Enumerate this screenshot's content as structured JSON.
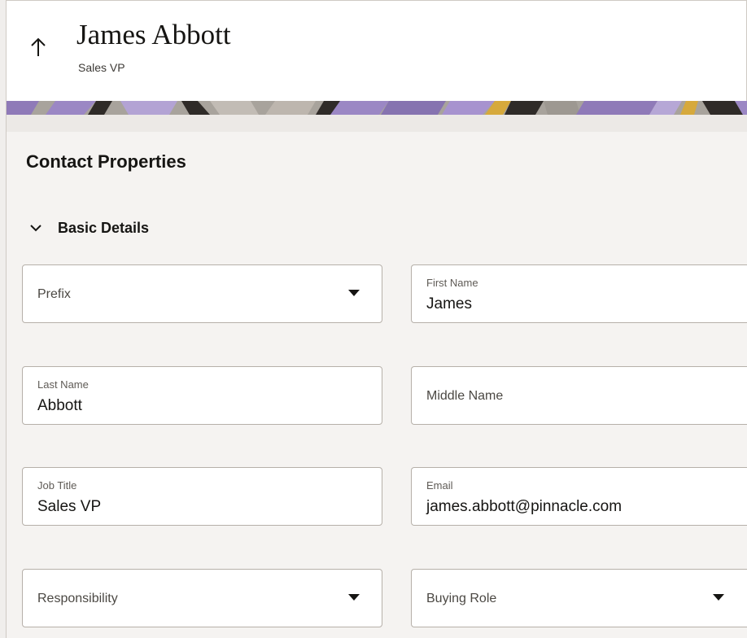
{
  "header": {
    "name": "James Abbott",
    "subtitle": "Sales VP",
    "back_icon": "arrow-up-icon"
  },
  "colors": {
    "banner_purple": "#9b87c4",
    "banner_dark": "#2f2b28",
    "banner_gold": "#d6a93c",
    "banner_gray": "#9d9891",
    "page_bg": "#f5f3f1"
  },
  "section": {
    "title": "Contact Properties"
  },
  "group": {
    "label": "Basic Details",
    "expanded": true,
    "toggle_icon": "chevron-down-icon"
  },
  "fields": {
    "prefix": {
      "label": "Prefix",
      "value": "",
      "type": "select"
    },
    "first_name": {
      "label": "First Name",
      "value": "James"
    },
    "last_name": {
      "label": "Last Name",
      "value": "Abbott"
    },
    "middle_name": {
      "label": "Middle Name",
      "value": ""
    },
    "job_title": {
      "label": "Job Title",
      "value": "Sales VP"
    },
    "email": {
      "label": "Email",
      "value": "james.abbott@pinnacle.com"
    },
    "responsibility": {
      "label": "Responsibility",
      "value": "",
      "type": "select"
    },
    "buying_role": {
      "label": "Buying Role",
      "value": "",
      "type": "select"
    }
  }
}
